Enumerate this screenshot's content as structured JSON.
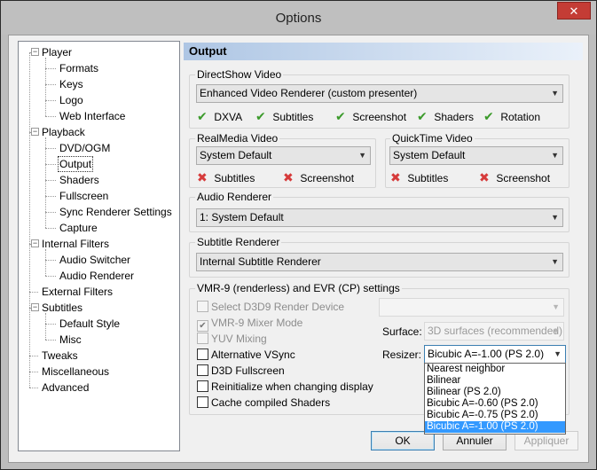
{
  "window": {
    "title": "Options",
    "close_glyph": "✕"
  },
  "tree": [
    {
      "label": "Player",
      "level": 0,
      "expander": true
    },
    {
      "label": "Formats",
      "level": 1
    },
    {
      "label": "Keys",
      "level": 1
    },
    {
      "label": "Logo",
      "level": 1
    },
    {
      "label": "Web Interface",
      "level": 1
    },
    {
      "label": "Playback",
      "level": 0,
      "expander": true
    },
    {
      "label": "DVD/OGM",
      "level": 1
    },
    {
      "label": "Output",
      "level": 1,
      "selected": true
    },
    {
      "label": "Shaders",
      "level": 1
    },
    {
      "label": "Fullscreen",
      "level": 1
    },
    {
      "label": "Sync Renderer Settings",
      "level": 1
    },
    {
      "label": "Capture",
      "level": 1
    },
    {
      "label": "Internal Filters",
      "level": 0,
      "expander": true
    },
    {
      "label": "Audio Switcher",
      "level": 1
    },
    {
      "label": "Audio Renderer",
      "level": 1
    },
    {
      "label": "External Filters",
      "level": 0
    },
    {
      "label": "Subtitles",
      "level": 0,
      "expander": true
    },
    {
      "label": "Default Style",
      "level": 1
    },
    {
      "label": "Misc",
      "level": 1
    },
    {
      "label": "Tweaks",
      "level": 0
    },
    {
      "label": "Miscellaneous",
      "level": 0
    },
    {
      "label": "Advanced",
      "level": 0
    }
  ],
  "panel": {
    "title": "Output"
  },
  "directshow": {
    "label": "DirectShow Video",
    "renderer": "Enhanced Video Renderer (custom presenter)",
    "caps": [
      {
        "label": "DXVA",
        "ok": true
      },
      {
        "label": "Subtitles",
        "ok": true
      },
      {
        "label": "Screenshot",
        "ok": true
      },
      {
        "label": "Shaders",
        "ok": true
      },
      {
        "label": "Rotation",
        "ok": true
      }
    ]
  },
  "realmedia": {
    "label": "RealMedia Video",
    "renderer": "System Default",
    "caps": [
      {
        "label": "Subtitles",
        "ok": false
      },
      {
        "label": "Screenshot",
        "ok": false
      }
    ]
  },
  "quicktime": {
    "label": "QuickTime Video",
    "renderer": "System Default",
    "caps": [
      {
        "label": "Subtitles",
        "ok": false
      },
      {
        "label": "Screenshot",
        "ok": false
      }
    ]
  },
  "audio": {
    "label": "Audio Renderer",
    "renderer": "1: System Default"
  },
  "subtitle": {
    "label": "Subtitle Renderer",
    "renderer": "Internal Subtitle Renderer"
  },
  "vmr": {
    "label": "VMR-9 (renderless) and EVR (CP) settings",
    "checkboxes": [
      {
        "label": "Select D3D9 Render Device",
        "checked": false,
        "enabled": false
      },
      {
        "label": "VMR-9 Mixer Mode",
        "checked": true,
        "enabled": false
      },
      {
        "label": "YUV Mixing",
        "checked": false,
        "enabled": false
      },
      {
        "label": "Alternative VSync",
        "checked": false,
        "enabled": true
      },
      {
        "label": "D3D Fullscreen",
        "checked": false,
        "enabled": true
      },
      {
        "label": "Reinitialize when changing display",
        "checked": false,
        "enabled": true
      },
      {
        "label": "Cache compiled Shaders",
        "checked": false,
        "enabled": true
      }
    ],
    "device_value": "",
    "surface_label": "Surface:",
    "surface_value": "3D surfaces (recommended)",
    "resizer_label": "Resizer:",
    "resizer_value": "Bicubic A=-1.00 (PS 2.0)",
    "resizer_options": [
      "Nearest neighbor",
      "Bilinear",
      "Bilinear (PS 2.0)",
      "Bicubic A=-0.60 (PS 2.0)",
      "Bicubic A=-0.75 (PS 2.0)",
      "Bicubic A=-1.00 (PS 2.0)"
    ],
    "resizer_selected_index": 5
  },
  "buttons": {
    "ok": "OK",
    "cancel": "Annuler",
    "apply": "Appliquer"
  },
  "colors": {
    "accent": "#3399ff",
    "ok": "#3a9a2a",
    "error": "#d63a3a"
  }
}
